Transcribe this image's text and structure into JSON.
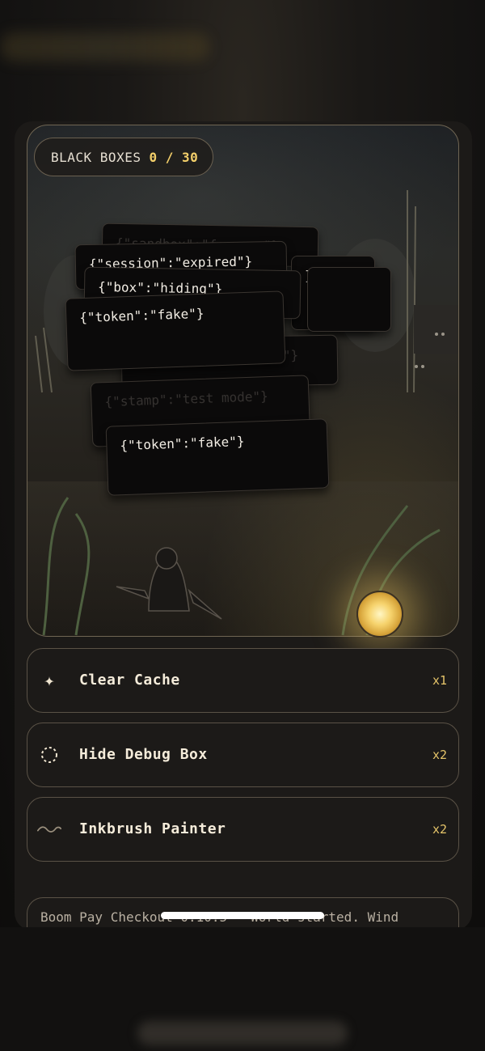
{
  "counter": {
    "label": "BLACK BOXES",
    "found": "0",
    "sep": "/",
    "total": "30"
  },
  "cards": [
    {
      "text": "{\"session\":\"expired\"}",
      "faded": false
    },
    {
      "text": "{\"box\":\"hiding\"}",
      "faded": false
    },
    {
      "text": "{\"token\":\"fake\"}",
      "faded": false
    },
    {
      "text": "{\"session\":\"expired\"}",
      "faded": true
    },
    {
      "text": "{\"stamp\":\"test mode\"}",
      "faded": true
    },
    {
      "text": "{\"token\":\"fake\"}",
      "faded": false
    },
    {
      "text": "}",
      "faded": false
    },
    {
      "text": "{\"sandbox\":\"forever\"}",
      "faded": true
    }
  ],
  "tools": [
    {
      "icon": "sparkle-icon",
      "name": "Clear Cache",
      "qty": "x1"
    },
    {
      "icon": "dashed-circle-icon",
      "name": "Hide Debug Box",
      "qty": "x2"
    },
    {
      "icon": "wave-icon",
      "name": "Inkbrush Painter",
      "qty": "x2"
    }
  ],
  "log": {
    "text": "Boom Pay Checkout 0.10.5 — World started. Wind"
  },
  "colors": {
    "accent": "#f3cf6a",
    "border": "#5a5246",
    "card": "#0b0a0a"
  }
}
